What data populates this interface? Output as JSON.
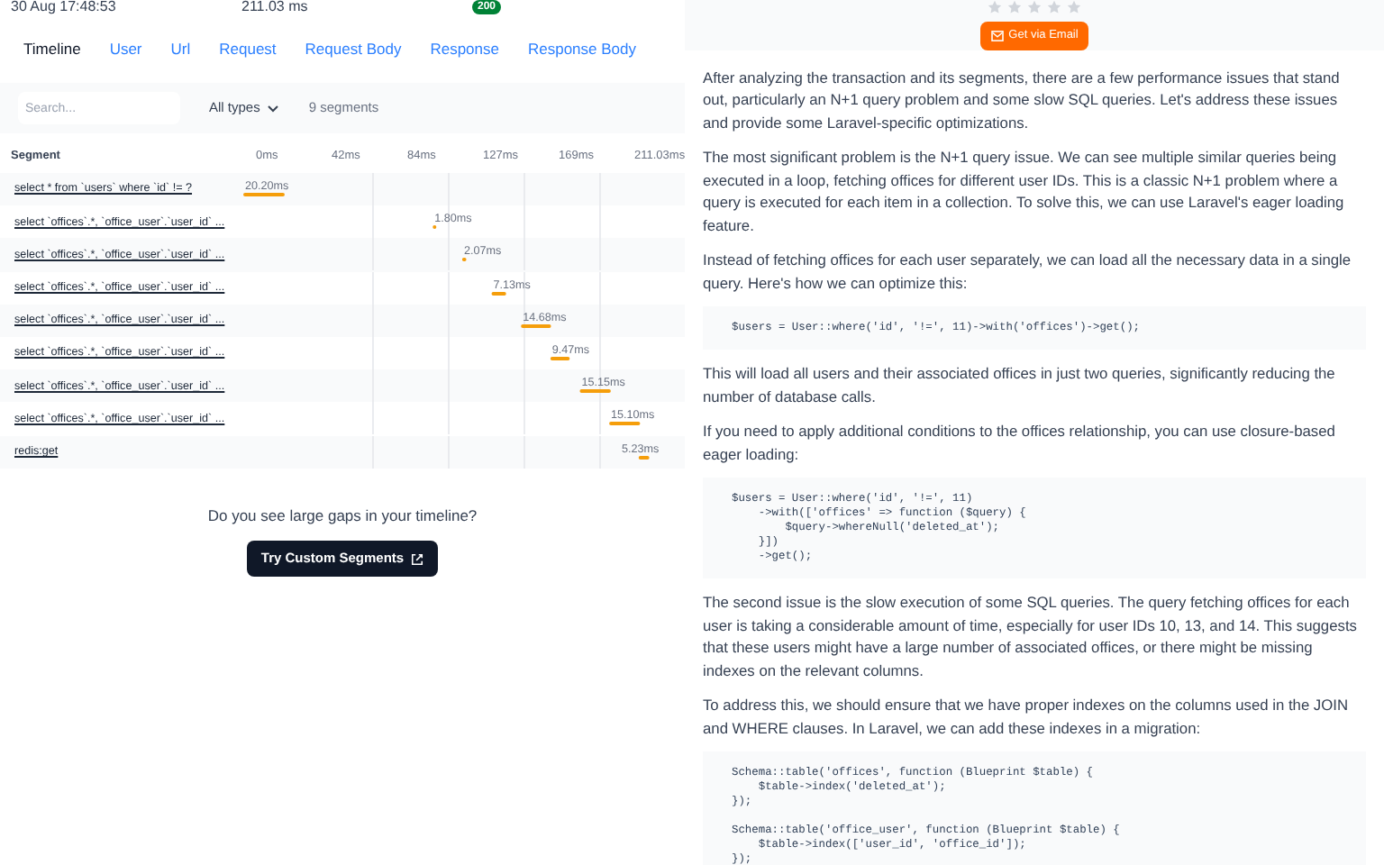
{
  "header": {
    "date": "30 Aug 17:48:53",
    "duration": "211.03 ms",
    "status": "200"
  },
  "tabs": [
    {
      "label": "Timeline",
      "selected": true
    },
    {
      "label": "User",
      "selected": false
    },
    {
      "label": "Url",
      "selected": false
    },
    {
      "label": "Request",
      "selected": false
    },
    {
      "label": "Request Body",
      "selected": false
    },
    {
      "label": "Response",
      "selected": false
    },
    {
      "label": "Response Body",
      "selected": false
    }
  ],
  "filter": {
    "search_placeholder": "Search...",
    "type_select": "All types",
    "count": "9 segments"
  },
  "timeline": {
    "column_header": "Segment",
    "ticks": [
      "0ms",
      "42ms",
      "84ms",
      "127ms",
      "169ms",
      "211.03ms"
    ],
    "rows": [
      {
        "segment": "select * from `users` where `id` != ?",
        "duration": "20.20ms"
      },
      {
        "segment": "select `offices`.*, `office_user`.`user_id` ...",
        "duration": "1.80ms"
      },
      {
        "segment": "select `offices`.*, `office_user`.`user_id` ...",
        "duration": "2.07ms"
      },
      {
        "segment": "select `offices`.*, `office_user`.`user_id` ...",
        "duration": "7.13ms"
      },
      {
        "segment": "select `offices`.*, `office_user`.`user_id` ...",
        "duration": "14.68ms"
      },
      {
        "segment": "select `offices`.*, `office_user`.`user_id` ...",
        "duration": "9.47ms"
      },
      {
        "segment": "select `offices`.*, `office_user`.`user_id` ...",
        "duration": "15.15ms"
      },
      {
        "segment": "select `offices`.*, `office_user`.`user_id` ...",
        "duration": "15.10ms"
      },
      {
        "segment": "redis:get",
        "duration": "5.23ms"
      }
    ]
  },
  "gaps_prompt": {
    "question": "Do you see large gaps in your timeline?",
    "button": "Try Custom Segments"
  },
  "feedback": {
    "stars": 0,
    "email_button": "Get via Email"
  },
  "analysis": [
    {
      "kind": "text",
      "text": "After analyzing the transaction and its segments, there are a few performance issues that stand out, particularly an N+1 query problem and some slow SQL queries. Let's address these issues and provide some Laravel-specific optimizations."
    },
    {
      "kind": "text",
      "text": "The most significant problem is the N+1 query issue. We can see multiple similar queries being executed in a loop, fetching offices for different user IDs. This is a classic N+1 problem where a query is executed for each item in a collection. To solve this, we can use Laravel's eager loading feature."
    },
    {
      "kind": "text",
      "text": "Instead of fetching offices for each user separately, we can load all the necessary data in a single query. Here's how we can optimize this:"
    },
    {
      "kind": "code",
      "text": "$users = User::where('id', '!=', 11)->with('offices')->get();"
    },
    {
      "kind": "text",
      "text": "This will load all users and their associated offices in just two queries, significantly reducing the number of database calls."
    },
    {
      "kind": "text",
      "text": "If you need to apply additional conditions to the offices relationship, you can use closure-based eager loading:"
    },
    {
      "kind": "code",
      "text": "$users = User::where('id', '!=', 11)\n    ->with(['offices' => function ($query) {\n        $query->whereNull('deleted_at');\n    }])\n    ->get();"
    },
    {
      "kind": "text",
      "text": "The second issue is the slow execution of some SQL queries. The query fetching offices for each user is taking a considerable amount of time, especially for user IDs 10, 13, and 14. This suggests that these users might have a large number of associated offices, or there might be missing indexes on the relevant columns."
    },
    {
      "kind": "text",
      "text": "To address this, we should ensure that we have proper indexes on the columns used in the JOIN and WHERE clauses. In Laravel, we can add these indexes in a migration:"
    },
    {
      "kind": "code",
      "text": "Schema::table('offices', function (Blueprint $table) {\n    $table->index('deleted_at');\n});\n\nSchema::table('office_user', function (Blueprint $table) {\n    $table->index(['user_id', 'office_id']);\n});"
    }
  ]
}
